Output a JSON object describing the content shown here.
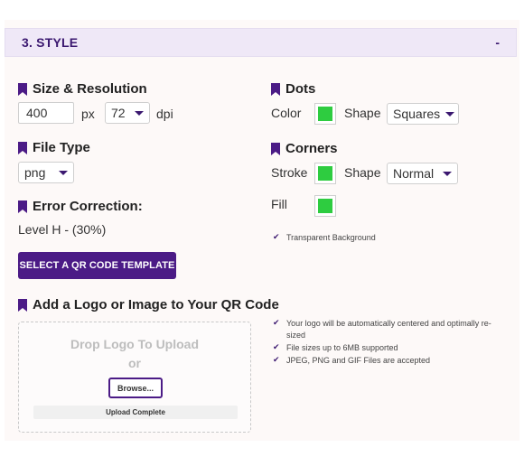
{
  "section": {
    "title": "3. STYLE",
    "collapse_label": "-"
  },
  "size_resolution": {
    "heading": "Size & Resolution",
    "size_value": "400",
    "size_unit": "px",
    "dpi_value": "72",
    "dpi_unit": "dpi"
  },
  "file_type": {
    "heading": "File Type",
    "value": "png"
  },
  "error_correction": {
    "heading": "Error Correction:",
    "value": "Level H - (30%)"
  },
  "template_button": "SELECT A QR CODE TEMPLATE",
  "dots": {
    "heading": "Dots",
    "color_label": "Color",
    "color": "#2ecc40",
    "shape_label": "Shape",
    "shape_value": "Squares"
  },
  "corners": {
    "heading": "Corners",
    "stroke_label": "Stroke",
    "stroke_color": "#2ecc40",
    "shape_label": "Shape",
    "shape_value": "Normal",
    "fill_label": "Fill",
    "fill_color": "#2ecc40"
  },
  "transparent_background": {
    "label": "Transparent Background",
    "checked": true
  },
  "logo": {
    "heading": "Add a Logo or Image to Your QR Code",
    "drop_title": "Drop Logo To Upload",
    "drop_or": "or",
    "browse_label": "Browse...",
    "upload_status": "Upload Complete",
    "notes_line1": "Your logo will be automatically centered and optimally re-",
    "notes_line1b": "sized",
    "notes_line2": "File sizes up to 6MB supported",
    "notes_line3": "JPEG, PNG and GIF Files are accepted"
  },
  "colors": {
    "accent": "#4b1b86",
    "header_bg": "#efe8f7",
    "swatch": "#2ecc40"
  },
  "icons": {
    "heading_marker": "bookmark-icon",
    "check": "check-icon",
    "dropdown": "chevron-down-icon"
  }
}
